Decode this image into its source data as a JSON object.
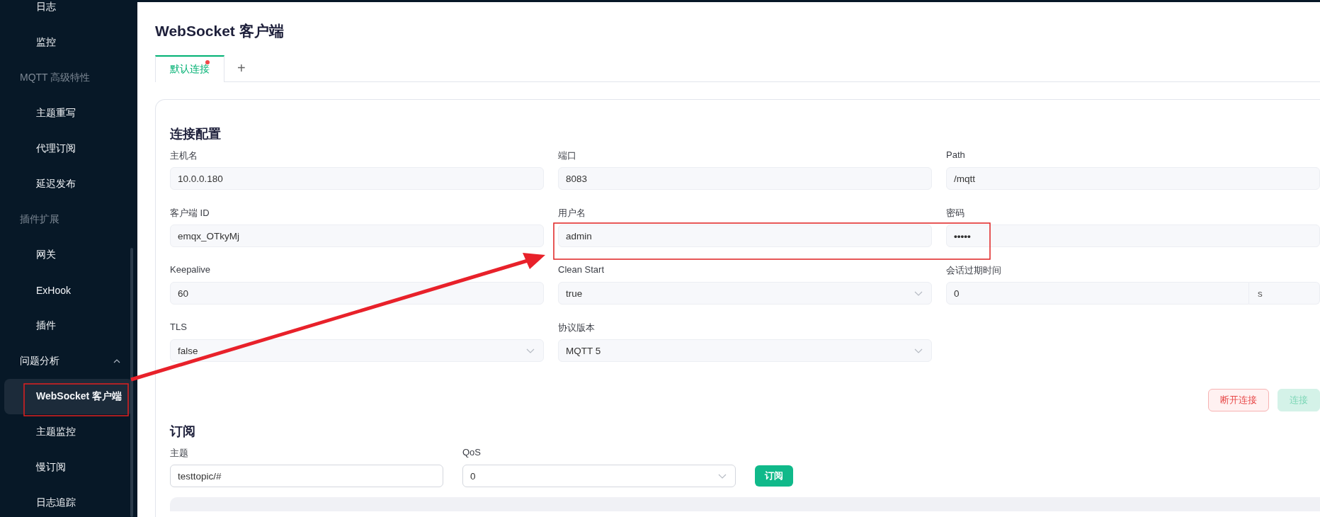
{
  "sidebar": {
    "items": [
      {
        "kind": "item",
        "label": "日志",
        "selected": false
      },
      {
        "kind": "item",
        "label": "监控",
        "selected": false
      },
      {
        "kind": "group",
        "label": "MQTT 高级特性"
      },
      {
        "kind": "item",
        "label": "主题重写",
        "selected": false
      },
      {
        "kind": "item",
        "label": "代理订阅",
        "selected": false
      },
      {
        "kind": "item",
        "label": "延迟发布",
        "selected": false
      },
      {
        "kind": "group",
        "label": "插件扩展"
      },
      {
        "kind": "item",
        "label": "网关",
        "selected": false
      },
      {
        "kind": "item",
        "label": "ExHook",
        "selected": false
      },
      {
        "kind": "item",
        "label": "插件",
        "selected": false
      },
      {
        "kind": "menu",
        "label": "问题分析",
        "expanded": true
      },
      {
        "kind": "item",
        "label": "WebSocket 客户端",
        "selected": true
      },
      {
        "kind": "item",
        "label": "主题监控",
        "selected": false
      },
      {
        "kind": "item",
        "label": "慢订阅",
        "selected": false
      },
      {
        "kind": "item",
        "label": "日志追踪",
        "selected": false
      }
    ]
  },
  "page_title": "WebSocket 客户端",
  "tabs": [
    {
      "label": "默认连接",
      "selected": true,
      "unsaved": true
    }
  ],
  "add_tab": "+",
  "connection": {
    "title": "连接配置",
    "fields": [
      {
        "kind": "input",
        "label": "主机名",
        "value": "10.0.0.180"
      },
      {
        "kind": "input",
        "label": "端口",
        "value": "8083"
      },
      {
        "kind": "input",
        "label": "Path",
        "value": "/mqtt"
      },
      {
        "kind": "input",
        "label": "客户端 ID",
        "value": "emqx_OTkyMj"
      },
      {
        "kind": "input",
        "label": "用户名",
        "value": "admin"
      },
      {
        "kind": "password",
        "label": "密码",
        "value": "•••••"
      },
      {
        "kind": "input",
        "label": "Keepalive",
        "value": "60"
      },
      {
        "kind": "select",
        "label": "Clean Start",
        "value": "true"
      },
      {
        "kind": "unit",
        "label": "会话过期时间",
        "value": "0",
        "unit": "s"
      },
      {
        "kind": "select",
        "label": "TLS",
        "value": "false"
      },
      {
        "kind": "select",
        "label": "协议版本",
        "value": "MQTT 5"
      }
    ],
    "buttons": [
      {
        "kind": "danger",
        "label": "断开连接",
        "disabled": false
      },
      {
        "kind": "primary",
        "label": "连接",
        "disabled": true
      }
    ]
  },
  "subscribe": {
    "title": "订阅",
    "topic_label": "主题",
    "topic": "testtopic/#",
    "qos_label": "QoS",
    "qos": "0",
    "button": "订阅"
  }
}
